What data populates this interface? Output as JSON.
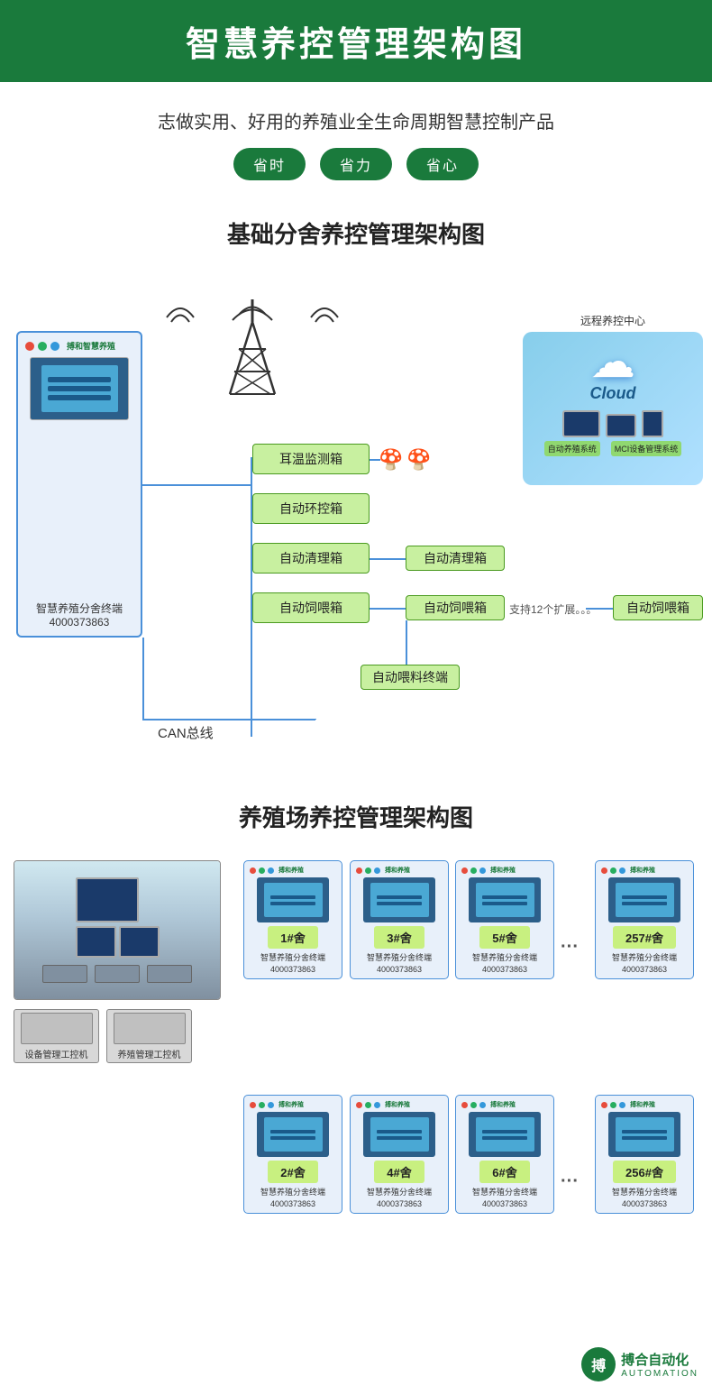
{
  "header": {
    "title": "智慧养控管理架构图",
    "bg_color": "#1a7a3c",
    "text_color": "#ffffff"
  },
  "subtitle": {
    "text": "志做实用、好用的养殖业全生命周期智慧控制产品",
    "badges": [
      "省时",
      "省力",
      "省心"
    ]
  },
  "section1": {
    "title": "基础分舍养控管理架构图",
    "terminal_label": "智慧养殖分舍终端",
    "terminal_phone": "4000373863",
    "can_label": "CAN总线",
    "cloud_label": "远程养控中心",
    "cloud_word": "Cloud",
    "cloud_bottom": [
      "自动养殖系统",
      "MCI设备管理系统"
    ],
    "boxes": [
      {
        "label": "耳温监测箱"
      },
      {
        "label": "自动环控箱"
      },
      {
        "label": "自动清理箱"
      },
      {
        "label": "自动饲喂箱"
      }
    ],
    "side_boxes": [
      {
        "label": "自动清理箱"
      },
      {
        "label": "自动饲喂箱"
      }
    ],
    "far_box": {
      "label": "自动饲喂箱"
    },
    "support_text": "支持12个扩展。。。",
    "feed_terminal": "自动喂料终端"
  },
  "section2": {
    "title": "养殖场养控管理架构图",
    "workstations": [
      "设备管理工控机",
      "养殖管理工控机"
    ],
    "terminals_row1": [
      {
        "shelf": "1#舍",
        "label": "智慧养殖分舍终端\n4000373863"
      },
      {
        "shelf": "3#舍",
        "label": "智慧养殖分舍终端\n4000373863"
      },
      {
        "shelf": "5#舍",
        "label": "智慧养殖分舍终端\n4000373863"
      },
      {
        "shelf": "257#舍",
        "label": "智慧养殖分舍终端\n4000373863"
      }
    ],
    "terminals_row2": [
      {
        "shelf": "2#舍",
        "label": "智慧养殖分舍终端\n4000373863"
      },
      {
        "shelf": "4#舍",
        "label": "智慧养殖分舍终端\n4000373863"
      },
      {
        "shelf": "6#舍",
        "label": "智慧养殖分舍终端\n4000373863"
      },
      {
        "shelf": "256#舍",
        "label": "智慧养殖分舍终端\n4000373863"
      }
    ]
  },
  "watermark": {
    "logo": "搏",
    "text": "搏合自动化",
    "sub": "AUTOMATION"
  }
}
